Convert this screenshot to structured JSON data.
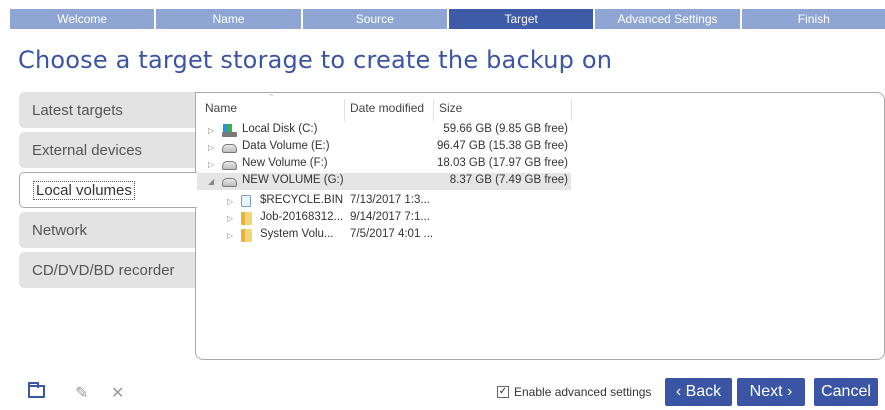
{
  "steps": [
    {
      "label": "Welcome",
      "active": false
    },
    {
      "label": "Name",
      "active": false
    },
    {
      "label": "Source",
      "active": false
    },
    {
      "label": "Target",
      "active": true
    },
    {
      "label": "Advanced Settings",
      "active": false
    },
    {
      "label": "Finish",
      "active": false
    }
  ],
  "page_title": "Choose a target storage to create the backup on",
  "categories": [
    "Latest targets",
    "External devices",
    "Local volumes",
    "Network",
    "CD/DVD/BD recorder"
  ],
  "selected_category": "Local volumes",
  "columns": {
    "name": "Name",
    "date": "Date modified",
    "size": "Size"
  },
  "sort_indicator": "ˆ",
  "drives": [
    {
      "name": "Local Disk (C:)",
      "size": "59.66 GB (9.85 GB free)",
      "icon": "system-drive-icon",
      "expanded": false
    },
    {
      "name": "Data Volume (E:)",
      "size": "96.47 GB (15.38 GB free)",
      "icon": "drive-icon",
      "expanded": false
    },
    {
      "name": "New Volume (F:)",
      "size": "18.03 GB (17.97 GB free)",
      "icon": "drive-icon",
      "expanded": false
    },
    {
      "name": "NEW VOLUME (G:)",
      "size": "8.37 GB (7.49 GB free)",
      "icon": "drive-icon",
      "expanded": true,
      "selected": true
    }
  ],
  "children": [
    {
      "name": "$RECYCLE.BIN",
      "date": "7/13/2017 1:3...",
      "icon": "recycle-bin-icon"
    },
    {
      "name": "Job-20168312...",
      "date": "9/14/2017 7:1...",
      "icon": "folder-icon"
    },
    {
      "name": "System Volu...",
      "date": "7/5/2017 4:01 ...",
      "icon": "folder-icon"
    }
  ],
  "glyphs": {
    "collapsed": "▷",
    "expanded": "◢",
    "pencil": "✎",
    "close": "✕",
    "check": "✓"
  },
  "enable_advanced": {
    "label": "Enable advanced settings",
    "checked": true
  },
  "buttons": {
    "back": "‹ Back",
    "next": "Next ›",
    "cancel": "Cancel"
  },
  "colors": {
    "accent": "#3a55a4",
    "step_inactive": "#8fa6d4",
    "step_active": "#3d5ba6"
  }
}
